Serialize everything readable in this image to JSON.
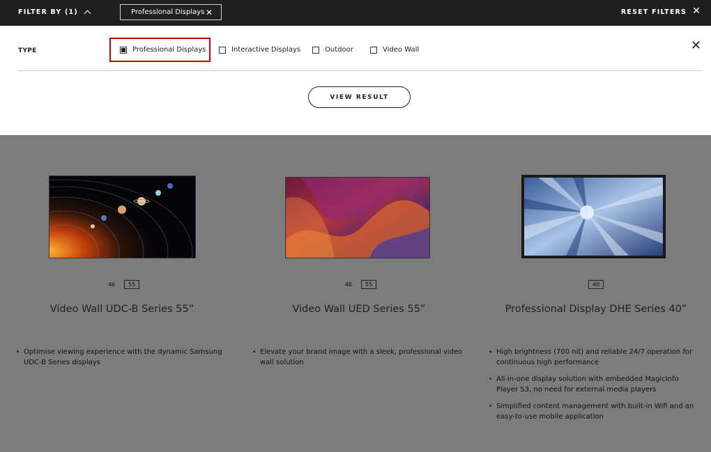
{
  "topbar": {
    "filter_by_label": "FILTER BY (1)",
    "active_chip": "Professional Displays",
    "chip_close": "✕",
    "reset_label": "RESET FILTERS",
    "reset_close": "✕"
  },
  "filter_panel": {
    "type_label": "TYPE",
    "options": [
      {
        "label": "Professional Displays",
        "checked": true
      },
      {
        "label": "Interactive Displays",
        "checked": false
      },
      {
        "label": "Outdoor",
        "checked": false
      },
      {
        "label": "Video Wall",
        "checked": false
      }
    ],
    "close": "✕",
    "view_result_label": "VIEW RESULT"
  },
  "products": [
    {
      "sizes": [
        {
          "label": "46",
          "selected": false
        },
        {
          "label": "55",
          "selected": true
        }
      ],
      "title": "Video Wall UDC-B Series 55”",
      "bullets": [
        "Optimise viewing experience with the dynamic Samsung UDC-B Series displays"
      ]
    },
    {
      "sizes": [
        {
          "label": "46",
          "selected": false
        },
        {
          "label": "55",
          "selected": true
        }
      ],
      "title": "Video Wall UED Series 55”",
      "bullets": [
        "Elevate your brand image with a sleek, professional video wall solution"
      ]
    },
    {
      "sizes": [
        {
          "label": "40",
          "selected": true
        }
      ],
      "title": "Professional Display DHE Series 40”",
      "bullets": [
        "High brightness (700 nit) and reliable 24/7 operation for continuous high performance",
        "All-in-one display solution with embedded MagicInfo Player S3, no need for external media players",
        "Simplified content management with built-in Wifi and an easy-to-use mobile application"
      ]
    }
  ]
}
